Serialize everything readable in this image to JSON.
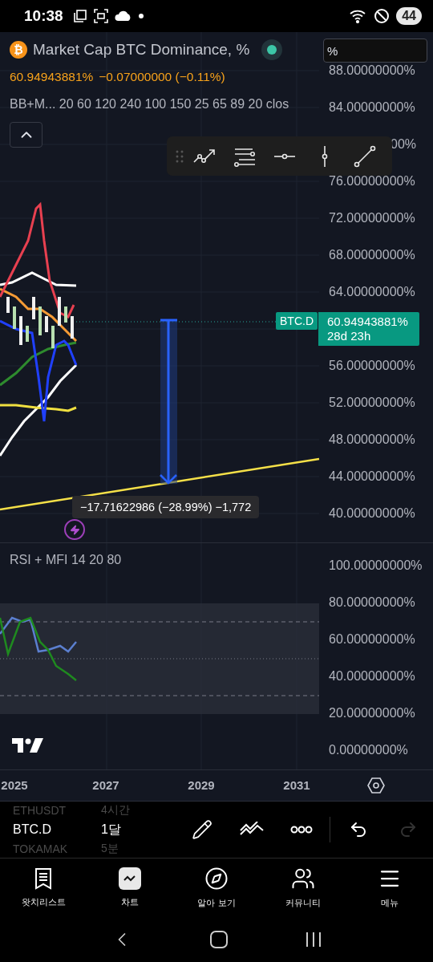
{
  "status_bar": {
    "time": "10:38",
    "battery": "44"
  },
  "chart": {
    "symbol_logo": "₿",
    "title": "Market Cap BTC Dominance, %",
    "market_open": true,
    "price": "60.94943881%",
    "change": "−0.07000000 (−0.11%)",
    "indicator": "BB+M... 20 60 120 240 100 150 25 65 89 20 clos",
    "scale_field": {
      "value": "%"
    },
    "price_axis_upper": [
      "88.00000000%",
      "84.00000000%",
      "00%",
      "76.00000000%",
      "72.00000000%",
      "68.00000000%",
      "64.00000000%"
    ],
    "price_axis_lower": [
      "56.00000000%",
      "52.00000000%",
      "48.00000000%",
      "44.00000000%",
      "40.00000000%"
    ],
    "last_price_tag": {
      "symbol": "BTC.D",
      "price": "60.94943881%",
      "countdown": "28d 23h"
    },
    "measure_label": "−17.71622986 (−28.99%) −1,772"
  },
  "rsi": {
    "title": "RSI + MFI 14 20 80",
    "axis": [
      "100.00000000%",
      "80.00000000%",
      "60.00000000%",
      "40.00000000%",
      "20.00000000%",
      "0.00000000%"
    ]
  },
  "time_axis": [
    "2025",
    "2027",
    "2029",
    "2031"
  ],
  "watchlist": [
    {
      "symbol": "ETHUSDT",
      "interval": "4시간",
      "selected": false
    },
    {
      "symbol": "BTC.D",
      "interval": "1달",
      "selected": true
    },
    {
      "symbol": "TOKAMAK",
      "interval": "5분",
      "selected": false
    }
  ],
  "drawing_bar": {
    "redo_disabled": true
  },
  "tabs": [
    {
      "kind": "watchlist",
      "label": "왓치리스트",
      "selected": false
    },
    {
      "kind": "chart",
      "label": "차트",
      "selected": true
    },
    {
      "kind": "explore",
      "label": "알아 보기",
      "selected": false
    },
    {
      "kind": "community",
      "label": "커뮤니티",
      "selected": false
    },
    {
      "kind": "menu",
      "label": "메뉴",
      "selected": false
    }
  ]
}
